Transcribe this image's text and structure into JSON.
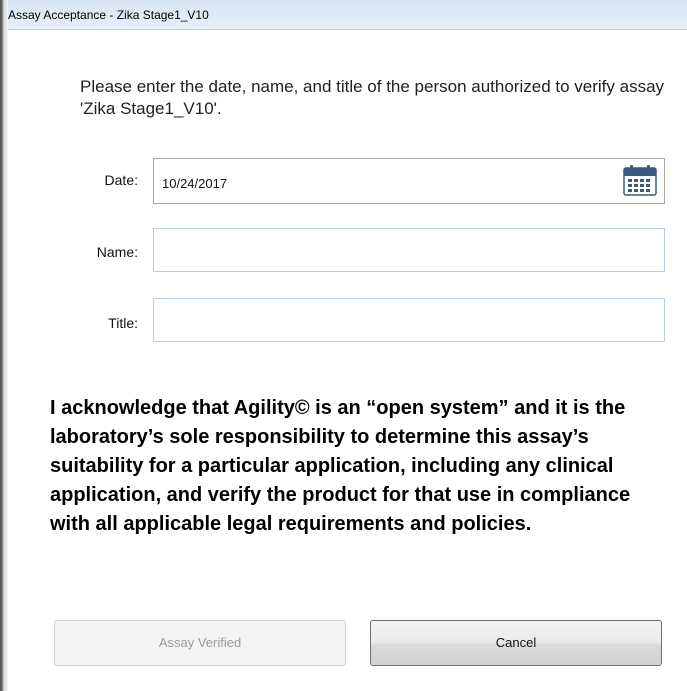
{
  "window": {
    "title": "Assay Acceptance - Zika Stage1_V10"
  },
  "instructions": "Please enter the date, name, and title of the person authorized to verify assay 'Zika Stage1_V10'.",
  "form": {
    "date": {
      "label": "Date:",
      "value": "10/24/2017",
      "icon": "calendar-icon"
    },
    "name": {
      "label": "Name:",
      "value": ""
    },
    "title": {
      "label": "Title:",
      "value": ""
    }
  },
  "acknowledgement": "I acknowledge that Agility© is an “open system” and it is the laboratory’s sole responsibility to determine this assay’s suitability for a particular application, including any clinical application, and verify the product for that use in compliance with all applicable legal requirements and policies.",
  "buttons": {
    "verified_label": "Assay Verified",
    "verified_enabled": false,
    "cancel_label": "Cancel"
  },
  "colors": {
    "titlebar": "#dfeaf7",
    "calendar_header": "#3a5a80",
    "disabled_text": "#9a9a9a"
  }
}
